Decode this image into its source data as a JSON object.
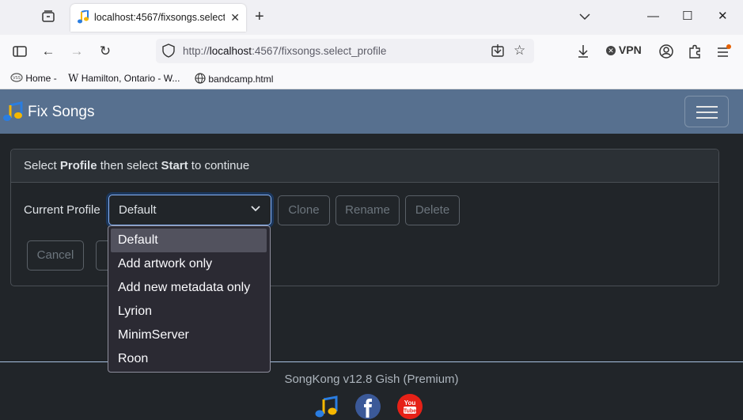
{
  "browser": {
    "tab_title": "localhost:4567/fixsongs.select_p",
    "url_prefix": "http://",
    "url_host": "localhost",
    "url_rest": ":4567/fixsongs.select_profile",
    "vpn_label": "VPN",
    "bookmarks": [
      {
        "label": "Home -",
        "icon": "home-bookmark-icon"
      },
      {
        "label": "Hamilton, Ontario - W...",
        "icon": "wikipedia-icon"
      },
      {
        "label": "bandcamp.html",
        "icon": "globe-icon"
      }
    ]
  },
  "app": {
    "brand": "Fix Songs",
    "header_prefix": "Select ",
    "header_bold1": "Profile",
    "header_mid": " then select ",
    "header_bold2": "Start",
    "header_suffix": " to continue",
    "profile_label": "Current Profile",
    "selected_profile": "Default",
    "buttons": {
      "clone": "Clone",
      "rename": "Rename",
      "delete": "Delete",
      "cancel": "Cancel"
    },
    "profile_options": [
      "Default",
      "Add artwork only",
      "Add new metadata only",
      "Lyrion",
      "MinimServer",
      "Roon"
    ],
    "footer": "SongKong v12.8 Gish (Premium)"
  },
  "colors": {
    "navbar": "#57708f",
    "background": "#212529",
    "facebook": "#3b5998",
    "youtube": "#e62117"
  }
}
